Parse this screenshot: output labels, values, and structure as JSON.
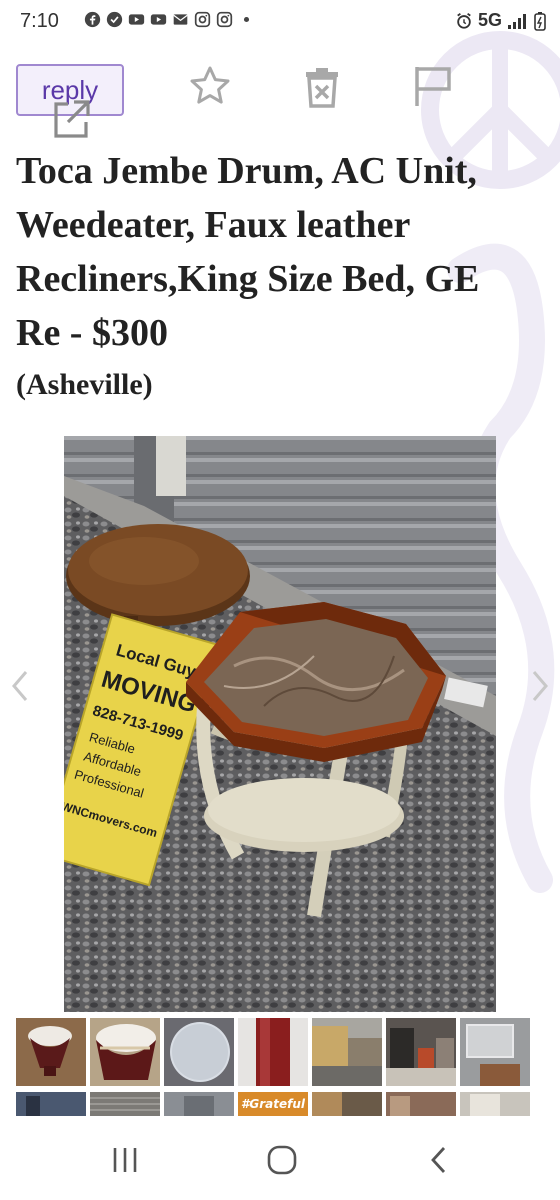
{
  "status_bar": {
    "time": "7:10",
    "network": "5G",
    "left_icons": [
      "facebook-icon",
      "check-badge-icon",
      "youtube-icon",
      "youtube-icon",
      "mail-icon",
      "instagram-icon",
      "instagram-icon",
      "dot-icon"
    ],
    "right_icons": [
      "alarm-icon",
      "signal-icon",
      "battery-icon"
    ]
  },
  "toolbar": {
    "reply_label": "reply",
    "icons": [
      "star-icon",
      "hide-icon",
      "flag-icon",
      "share-icon"
    ]
  },
  "post": {
    "title": "Toca Jembe Drum, AC Unit, Weedeater, Faux leather Recliners,King Size Bed, GE Re - $300",
    "location": "(Asheville)"
  },
  "gallery": {
    "sign_text": [
      "Local Guys",
      "MOVING?",
      "828-713-1999",
      "Reliable",
      "Affordable",
      "Professional",
      "WNCmovers.com"
    ]
  },
  "thumbnails": {
    "row2_caption": "#Grateful"
  },
  "colors": {
    "accent_purple": "#5a38a8",
    "reply_border": "#a088d0",
    "title_text": "#222222",
    "icon_gray": "#9a9a9a"
  }
}
